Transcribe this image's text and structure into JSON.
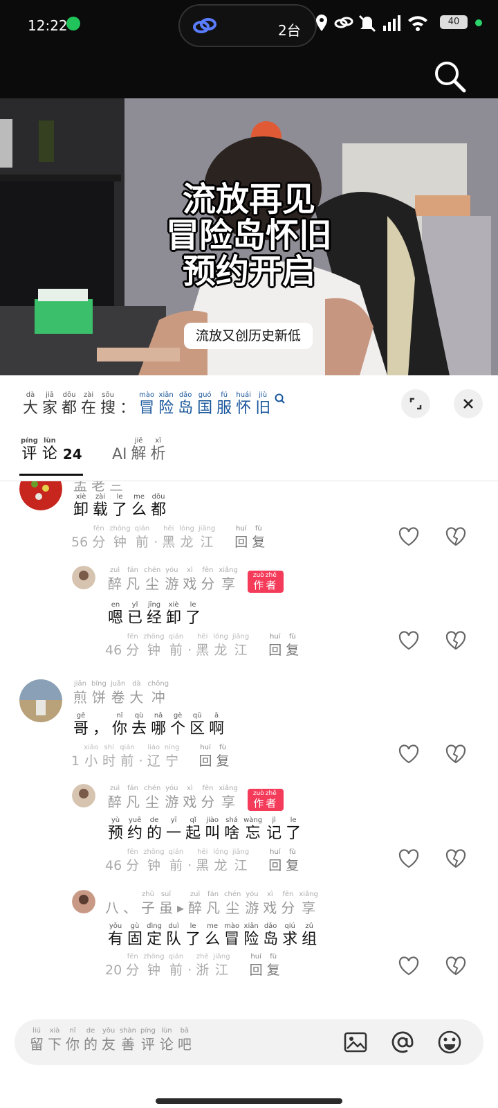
{
  "status_bar": {
    "time": "12:22",
    "island_count": "2台",
    "battery": "40"
  },
  "video": {
    "headline": [
      "流放再见",
      "冒险岛怀旧",
      "预约开启"
    ],
    "caption": "流放又创历史新低"
  },
  "trend": {
    "prefix": [
      [
        "大",
        "dà"
      ],
      [
        "家",
        "jiā"
      ],
      [
        "都",
        "dōu"
      ],
      [
        "在",
        "zài"
      ],
      [
        "搜",
        "sōu"
      ],
      [
        "：",
        ""
      ]
    ],
    "keyword": [
      [
        "冒",
        "mào"
      ],
      [
        "险",
        "xiǎn"
      ],
      [
        "岛",
        "dǎo"
      ],
      [
        "国",
        "guó"
      ],
      [
        "服",
        "fú"
      ],
      [
        "怀",
        "huái"
      ],
      [
        "旧",
        "jiù"
      ]
    ]
  },
  "tabs": {
    "comments_label": [
      [
        "评",
        "píng"
      ],
      [
        "论",
        "lùn"
      ]
    ],
    "comments_count": "24",
    "ai_prefix": "AI",
    "ai_label": [
      [
        "解",
        "jiě"
      ],
      [
        "析",
        "xī"
      ]
    ]
  },
  "comments": [
    {
      "name": [
        [
          "孟",
          ""
        ],
        [
          "老",
          ""
        ],
        [
          "三",
          ""
        ]
      ],
      "text": [
        [
          "卸",
          "xiè"
        ],
        [
          "载",
          "zài"
        ],
        [
          "了",
          "le"
        ],
        [
          "么",
          "me"
        ],
        [
          "都",
          "dōu"
        ]
      ],
      "meta": [
        [
          "56",
          ""
        ],
        [
          "分",
          "fēn"
        ],
        [
          "钟",
          "zhōng"
        ],
        [
          "前",
          "qián"
        ],
        [
          "·",
          ""
        ],
        [
          "黑",
          "hēi"
        ],
        [
          "龙",
          "lóng"
        ],
        [
          "江",
          "jiāng"
        ]
      ]
    },
    {
      "name": [
        [
          "醉",
          "zuì"
        ],
        [
          "凡",
          "fán"
        ],
        [
          "尘",
          "chén"
        ],
        [
          "游",
          "yóu"
        ],
        [
          "戏",
          "xì"
        ],
        [
          "分",
          "fēn"
        ],
        [
          "享",
          "xiǎng"
        ]
      ],
      "badge": [
        [
          "作",
          "zuò"
        ],
        [
          "者",
          "zhě"
        ]
      ],
      "text": [
        [
          "嗯",
          "en"
        ],
        [
          "已",
          "yǐ"
        ],
        [
          "经",
          "jīng"
        ],
        [
          "卸",
          "xiè"
        ],
        [
          "了",
          "le"
        ]
      ],
      "meta": [
        [
          "46",
          ""
        ],
        [
          "分",
          "fēn"
        ],
        [
          "钟",
          "zhōng"
        ],
        [
          "前",
          "qián"
        ],
        [
          "·",
          ""
        ],
        [
          "黑",
          "hēi"
        ],
        [
          "龙",
          "lóng"
        ],
        [
          "江",
          "jiāng"
        ]
      ]
    },
    {
      "name": [
        [
          "煎",
          "jiān"
        ],
        [
          "饼",
          "bǐng"
        ],
        [
          "卷",
          "juǎn"
        ],
        [
          "大",
          "dà"
        ],
        [
          "冲",
          "chōng"
        ]
      ],
      "text": [
        [
          "哥",
          "gē"
        ],
        [
          "，",
          ""
        ],
        [
          "你",
          "nǐ"
        ],
        [
          "去",
          "qù"
        ],
        [
          "哪",
          "nǎ"
        ],
        [
          "个",
          "gè"
        ],
        [
          "区",
          "qū"
        ],
        [
          "啊",
          "ā"
        ]
      ],
      "meta": [
        [
          "1",
          ""
        ],
        [
          "小",
          "xiǎo"
        ],
        [
          "时",
          "shí"
        ],
        [
          "前",
          "qián"
        ],
        [
          "·",
          ""
        ],
        [
          "辽",
          "liáo"
        ],
        [
          "宁",
          "níng"
        ]
      ]
    },
    {
      "name": [
        [
          "醉",
          "zuì"
        ],
        [
          "凡",
          "fán"
        ],
        [
          "尘",
          "chén"
        ],
        [
          "游",
          "yóu"
        ],
        [
          "戏",
          "xì"
        ],
        [
          "分",
          "fēn"
        ],
        [
          "享",
          "xiǎng"
        ]
      ],
      "badge": [
        [
          "作",
          "zuò"
        ],
        [
          "者",
          "zhě"
        ]
      ],
      "text": [
        [
          "预",
          "yù"
        ],
        [
          "约",
          "yuē"
        ],
        [
          "的",
          "de"
        ],
        [
          "一",
          "yī"
        ],
        [
          "起",
          "qǐ"
        ],
        [
          "叫",
          "jiào"
        ],
        [
          "啥",
          "shá"
        ],
        [
          "忘",
          "wàng"
        ],
        [
          "记",
          "jì"
        ],
        [
          "了",
          "le"
        ]
      ],
      "meta": [
        [
          "46",
          ""
        ],
        [
          "分",
          "fēn"
        ],
        [
          "钟",
          "zhōng"
        ],
        [
          "前",
          "qián"
        ],
        [
          "·",
          ""
        ],
        [
          "黑",
          "hēi"
        ],
        [
          "龙",
          "lóng"
        ],
        [
          "江",
          "jiāng"
        ]
      ]
    },
    {
      "name": [
        [
          "八",
          ""
        ],
        [
          "、",
          ""
        ],
        [
          "子",
          "zhū"
        ],
        [
          "虽",
          "suī"
        ],
        [
          "▸",
          ""
        ],
        [
          "醉",
          "zuì"
        ],
        [
          "凡",
          "fán"
        ],
        [
          "尘",
          "chén"
        ],
        [
          "游",
          "yóu"
        ],
        [
          "戏",
          "xì"
        ],
        [
          "分",
          "fēn"
        ],
        [
          "享",
          "xiǎng"
        ]
      ],
      "text": [
        [
          "有",
          "yǒu"
        ],
        [
          "固",
          "gù"
        ],
        [
          "定",
          "dìng"
        ],
        [
          "队",
          "duì"
        ],
        [
          "了",
          "le"
        ],
        [
          "么",
          "me"
        ],
        [
          "冒",
          "mào"
        ],
        [
          "险",
          "xiǎn"
        ],
        [
          "岛",
          "dǎo"
        ],
        [
          "求",
          "qiú"
        ],
        [
          "组",
          "zǔ"
        ]
      ],
      "meta": [
        [
          "20",
          ""
        ],
        [
          "分",
          "fēn"
        ],
        [
          "钟",
          "zhōng"
        ],
        [
          "前",
          "qián"
        ],
        [
          "·",
          ""
        ],
        [
          "浙",
          "zhè"
        ],
        [
          "江",
          "jiāng"
        ]
      ]
    }
  ],
  "reply_label": [
    [
      "回",
      "huí"
    ],
    [
      "复",
      "fù"
    ]
  ],
  "input": {
    "placeholder": [
      [
        "留",
        "liú"
      ],
      [
        "下",
        "xià"
      ],
      [
        "你",
        "nǐ"
      ],
      [
        "的",
        "de"
      ],
      [
        "友",
        "yǒu"
      ],
      [
        "善",
        "shàn"
      ],
      [
        "评",
        "píng"
      ],
      [
        "论",
        "lùn"
      ],
      [
        "吧",
        "bā"
      ]
    ]
  },
  "colors": {
    "keyword": "#16549a",
    "badge": "#f43b5a",
    "status_bar": "#0b0b0b"
  }
}
